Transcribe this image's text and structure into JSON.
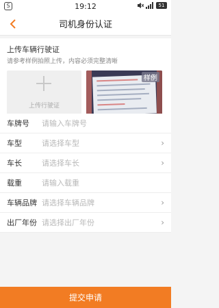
{
  "status_bar": {
    "time": "19:12",
    "battery_label": "51"
  },
  "header": {
    "title": "司机身份认证"
  },
  "upload": {
    "title": "上传车辆行驶证",
    "subtitle": "请参考样例拍照上传，内容必须完整清晰",
    "box_label": "上传行驶证",
    "sample_label": "样例"
  },
  "form": {
    "fields": [
      {
        "label": "车牌号",
        "placeholder": "请输入车牌号",
        "has_arrow": false
      },
      {
        "label": "车型",
        "placeholder": "请选择车型",
        "has_arrow": true
      },
      {
        "label": "车长",
        "placeholder": "请选择车长",
        "has_arrow": true
      },
      {
        "label": "载重",
        "placeholder": "请输入载重",
        "has_arrow": false
      },
      {
        "label": "车辆品牌",
        "placeholder": "请选择车辆品牌",
        "has_arrow": true
      },
      {
        "label": "出厂年份",
        "placeholder": "请选择出厂年份",
        "has_arrow": true
      }
    ]
  },
  "actions": {
    "submit_label": "提交申请"
  },
  "colors": {
    "accent": "#f27c23",
    "page_bg": "#f4f4f4"
  },
  "icons": {
    "back": "back-arrow-icon",
    "plus": "plus-icon",
    "chevron": "chevron-right-icon",
    "mute": "mute-icon",
    "signal": "signal-icon",
    "battery": "battery-icon"
  }
}
